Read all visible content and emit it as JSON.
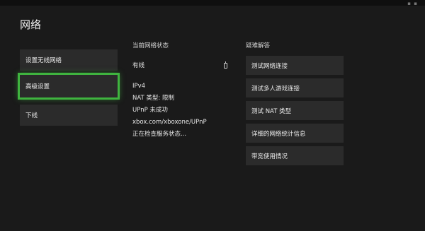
{
  "page": {
    "title": "网络"
  },
  "menu": {
    "items": [
      {
        "label": "设置无线网络"
      },
      {
        "label": "高级设置"
      },
      {
        "label": "下线"
      }
    ]
  },
  "status": {
    "title": "当前网络状态",
    "connection": "有线",
    "ip_version": "IPv4",
    "nat": "NAT 类型: 限制",
    "upnp": "UPnP 未成功",
    "link": "xbox.com/xboxone/UPnP",
    "checking": "正在检查服务状态..."
  },
  "troubleshoot": {
    "title": "疑难解答",
    "buttons": [
      {
        "label": "测试网络连接"
      },
      {
        "label": "测试多人游戏连接"
      },
      {
        "label": "测试 NAT 类型"
      },
      {
        "label": "详细的网络统计信息"
      },
      {
        "label": "带宽使用情况"
      }
    ]
  },
  "colors": {
    "background": "#1a1a1a",
    "tile": "#2b2b2b",
    "focus_accent": "#3fb43f"
  },
  "icons": {
    "connection": "ethernet-plug-icon"
  }
}
